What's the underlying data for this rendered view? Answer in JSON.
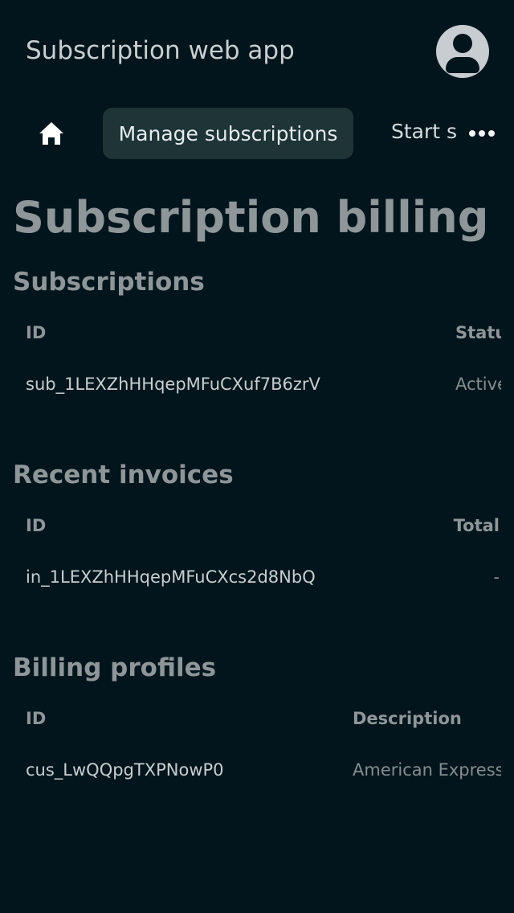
{
  "app": {
    "title": "Subscription web app",
    "avatar_icon": "account-circle-icon"
  },
  "nav": {
    "home_icon": "home-icon",
    "tabs": [
      {
        "label": "Manage subscriptions",
        "active": true
      },
      {
        "label": "Start subscription",
        "active": false
      }
    ],
    "more_icon": "more-horizontal-icon"
  },
  "page": {
    "title": "Subscription billing"
  },
  "subscriptions": {
    "title": "Subscriptions",
    "columns": [
      "ID",
      "Status"
    ],
    "rows": [
      {
        "id": "sub_1LEXZhHHqepMFuCXuf7B6zrV",
        "status": "Active"
      }
    ]
  },
  "invoices": {
    "title": "Recent invoices",
    "columns": [
      "ID",
      "Total"
    ],
    "rows": [
      {
        "id": "in_1LEXZhHHqepMFuCXcs2d8NbQ",
        "total": "-"
      }
    ]
  },
  "billing_profiles": {
    "title": "Billing profiles",
    "columns": [
      "ID",
      "Description"
    ],
    "rows": [
      {
        "id": "cus_LwQQpgTXPNowP0",
        "description": "American Express"
      }
    ]
  },
  "colors": {
    "background": "#02151c",
    "active_tab": "#1e3437",
    "muted_heading": "#8e9699"
  }
}
